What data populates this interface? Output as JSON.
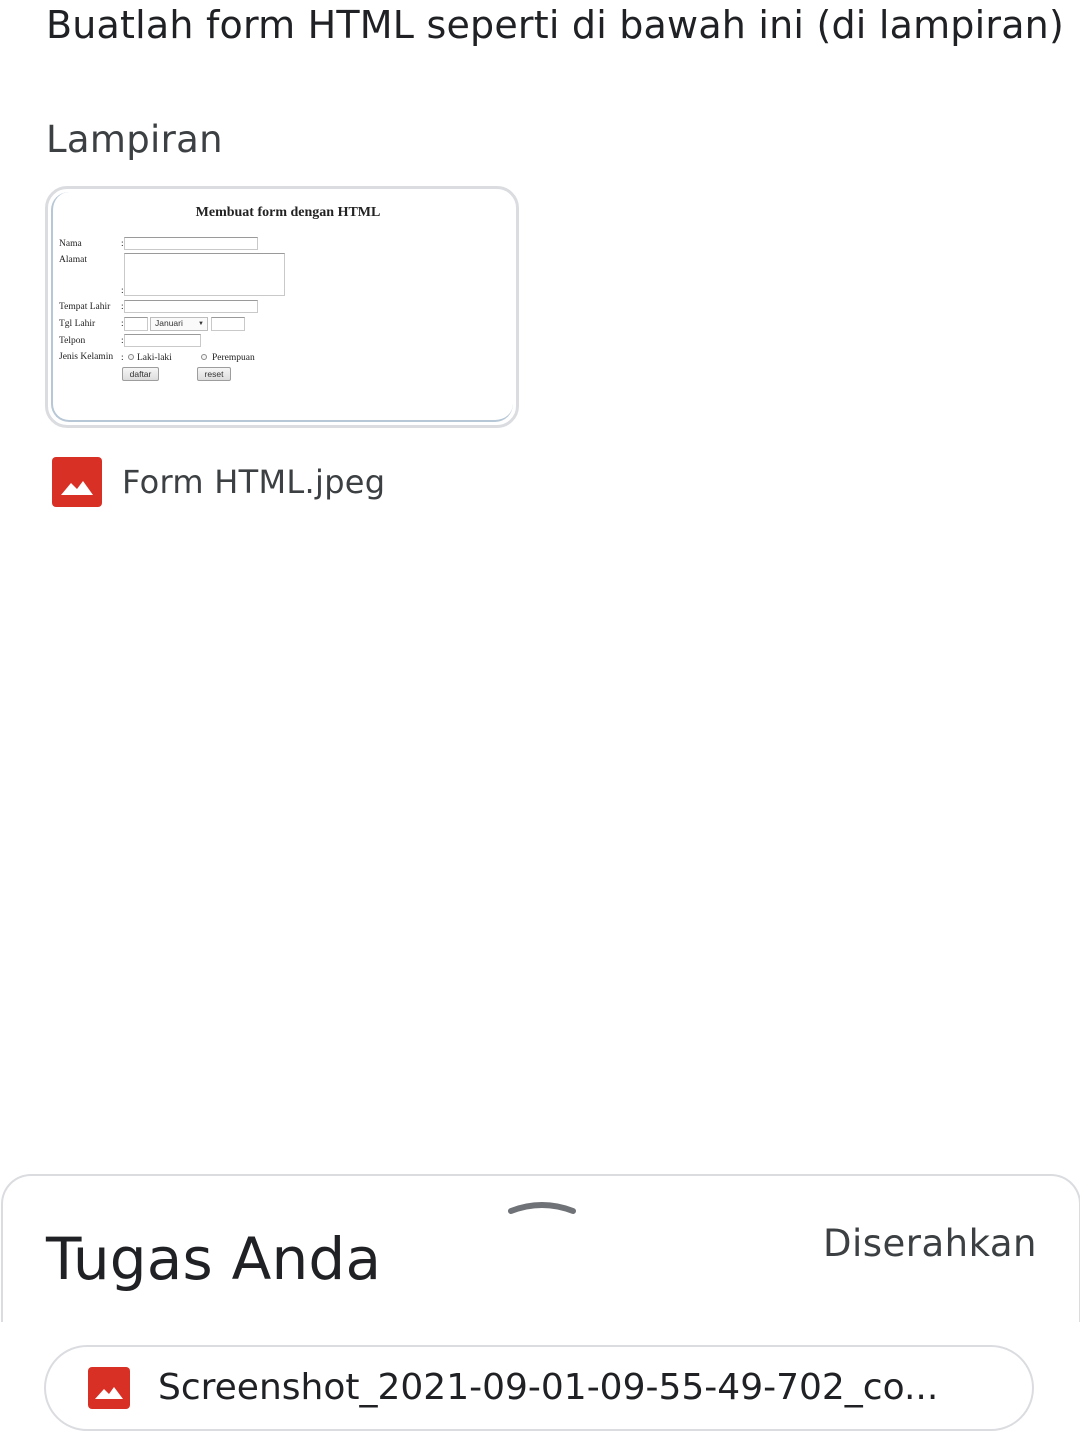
{
  "instructions": "Buatlah form HTML seperti di bawah ini (di lampiran)",
  "attachments": {
    "heading": "Lampiran",
    "preview": {
      "title": "Membuat form dengan HTML",
      "labels": {
        "nama": "Nama",
        "alamat": "Alamat",
        "tempat_lahir": "Tempat Lahir",
        "tgl_lahir": "Tgl Lahir",
        "telpon": "Telpon",
        "jenis_kelamin": "Jenis Kelamin"
      },
      "colon": ":",
      "month_value": "Januari",
      "gender_options": [
        "Laki-laki",
        "Perempuan"
      ],
      "submit_label": "daftar",
      "reset_label": "reset"
    },
    "file": {
      "name": "Form HTML.jpeg",
      "icon": "image-icon"
    }
  },
  "your_work": {
    "title": "Tugas Anda",
    "status": "Diserahkan",
    "handle_icon": "chevron-up-icon",
    "submission": {
      "name": "Screenshot_2021-09-01-09-55-49-702_co...",
      "icon": "image-icon"
    }
  },
  "colors": {
    "image_icon": "#d93025",
    "border": "#dadce0",
    "text": "#202124"
  }
}
